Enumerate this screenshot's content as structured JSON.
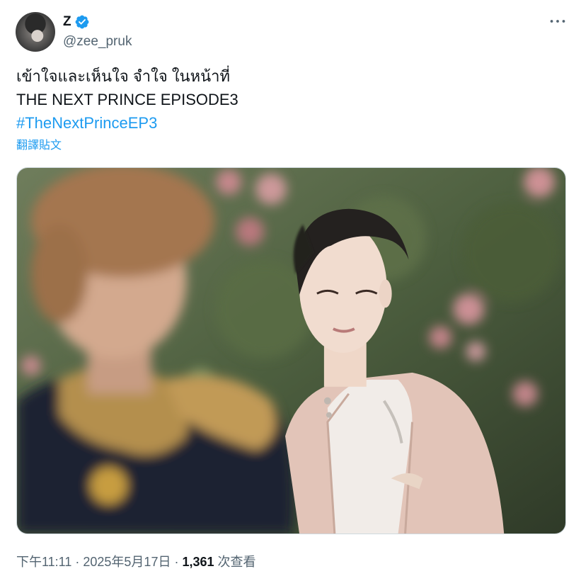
{
  "author": {
    "display_name": "Z",
    "handle": "@zee_pruk",
    "verified": true,
    "avatar_icon": "profile-photo"
  },
  "tweet": {
    "line1": "เข้าใจและเห็นใจ จำใจ ในหน้าที่",
    "line2": "THE NEXT PRINCE EPISODE3",
    "hashtag": "#TheNextPrinceEP3",
    "translate_label": "翻譯貼文"
  },
  "media": {
    "description_icon": "photo"
  },
  "meta": {
    "time": "下午11:11",
    "sep1": " · ",
    "date": "2025年5月17日",
    "sep2": " · ",
    "views": "1,361",
    "views_label": " 次查看"
  },
  "colors": {
    "link": "#1d9bf0",
    "secondary_text": "#536471",
    "primary_text": "#0f1419",
    "verified": "#1d9bf0"
  }
}
